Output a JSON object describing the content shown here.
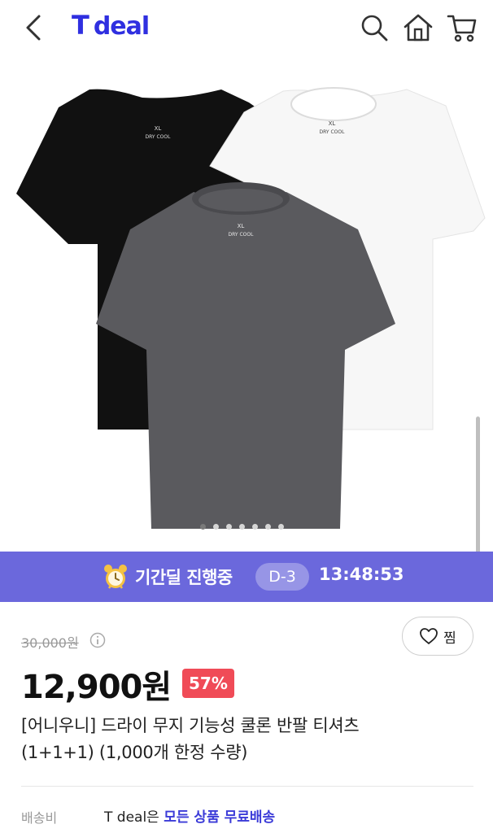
{
  "header": {
    "logo_t": "T",
    "logo_word": "deal",
    "icons": [
      "back-icon",
      "search-icon",
      "home-icon",
      "cart-icon"
    ]
  },
  "hero": {
    "slides_total": 7,
    "active_slide": 1,
    "tag_size": "XL",
    "tag_brand": "DRY COOL"
  },
  "deal_banner": {
    "label": "기간딜 진행중",
    "dday": "D-3",
    "timer": "13:48:53",
    "color": "#6b68dc"
  },
  "product": {
    "original_price": "30,000원",
    "price": "12,900원",
    "discount": "57%",
    "title_line1": "[어니우니] 드라이 무지 기능성 쿨론 반팔 티셔츠",
    "title_line2": "(1+1+1) (1,000개 한정 수량)",
    "wish_label": "찜"
  },
  "shipping": {
    "label": "배송비",
    "prefix": "T deal은 ",
    "highlight": "모든 상품 무료배송"
  },
  "colors": {
    "brand": "#2f2fe0",
    "discount_badge": "#f04b57",
    "shipping_highlight": "#3b3bd8"
  }
}
